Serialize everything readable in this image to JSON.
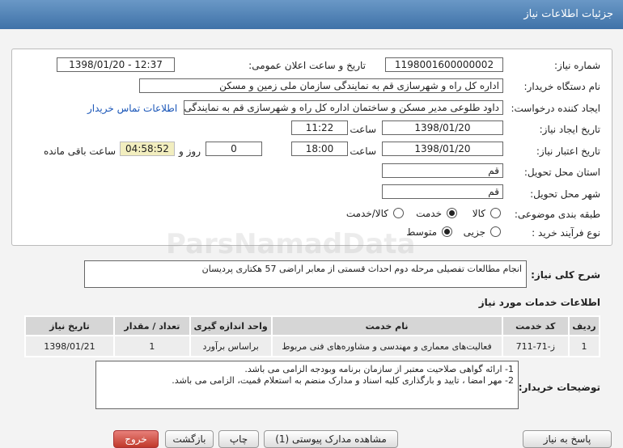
{
  "header": {
    "title": "جزئیات اطلاعات نیاز"
  },
  "fields": {
    "need_number_label": "شماره نیاز:",
    "need_number": "1198001600000002",
    "announce_label": "تاریخ و ساعت اعلان عمومی:",
    "announce_value": "1398/01/20 - 12:37",
    "buyer_label": "نام دستگاه خریدار:",
    "buyer_value": "اداره کل راه و شهرسازی قم به نمایندگی سازمان ملی زمین و مسکن",
    "requester_label": "ایجاد کننده درخواست:",
    "requester_value": "داود طلوعی مدیر مسکن و ساختمان اداره کل راه و شهرسازی قم به نمایندگی سازمان ملی",
    "contact_link": "اطلاعات تماس خریدار",
    "created_label": "تاریخ ایجاد نیاز:",
    "created_date": "1398/01/20",
    "time_label": "ساعت",
    "created_time": "11:22",
    "validity_label": "تاریخ اعتبار نیاز:",
    "validity_date": "1398/01/20",
    "validity_time": "18:00",
    "days_value": "0",
    "days_label": "روز و",
    "remaining_value": "04:58:52",
    "remaining_label": "ساعت باقی مانده",
    "province_label": "استان محل تحویل:",
    "province_value": "قم",
    "city_label": "شهر محل تحویل:",
    "city_value": "قم",
    "category_label": "طبقه بندی موضوعی:",
    "category_options": [
      "کالا",
      "خدمت",
      "کالا/خدمت"
    ],
    "category_selected": "خدمت",
    "process_label": "نوع فرآیند خرید :",
    "process_options": [
      "جزیی",
      "متوسط"
    ],
    "process_selected": "متوسط"
  },
  "summary": {
    "label": "شرح کلی نیاز:",
    "value": "انجام مطالعات تفصیلی مرحله دوم احداث قسمتی از معابر اراضی 57 هکتاری پردیسان"
  },
  "services": {
    "title": "اطلاعات خدمات مورد نیاز",
    "columns": [
      "ردیف",
      "کد خدمت",
      "نام خدمت",
      "واحد اندازه گیری",
      "تعداد / مقدار",
      "تاریخ نیاز"
    ],
    "rows": [
      [
        "1",
        "ز-71-711",
        "فعالیت‌های معماری و مهندسی و مشاوره‌های فنی مربوط",
        "براساس برآورد",
        "1",
        "1398/01/21"
      ]
    ]
  },
  "buyer_notes": {
    "label": "توضیحات خریدار:",
    "line1": "1- ارائه گواهی صلاحیت معتبر از سازمان برنامه وبودجه الزامی می باشد.",
    "line2": "2- مهر امضا ، تایید و بارگذاری کلیه اسناد و مدارک منضم به استعلام قمیت، الزامی می باشد."
  },
  "buttons": {
    "reply": "پاسخ به نیاز",
    "view_docs": "مشاهده مدارک پیوستی (1)",
    "print": "چاپ",
    "back": "بازگشت",
    "exit": "خروج"
  },
  "watermark": {
    "latin": "ParsNamadData"
  }
}
